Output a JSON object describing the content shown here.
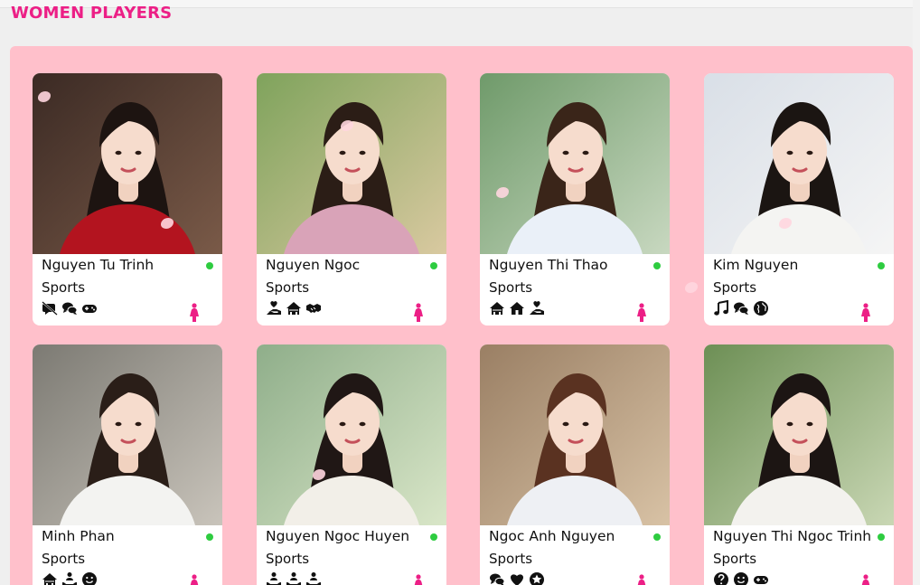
{
  "page": {
    "section_title": "WOMEN PLAYERS",
    "accent_color": "#ec1f86",
    "panel_color": "#ffc0cb",
    "online_color": "#2ecc40"
  },
  "players": [
    {
      "name": "Nguyen Tu Trinh",
      "category": "Sports",
      "online": true,
      "gender_icon": "female-icon",
      "hobby_icons": [
        "no-chat-icon",
        "chat-bubbles-icon",
        "gamepad-icon"
      ]
    },
    {
      "name": "Nguyen Ngoc",
      "category": "Sports",
      "online": true,
      "gender_icon": "female-icon",
      "hobby_icons": [
        "hand-heart-icon",
        "house-icon",
        "handshake-icon"
      ]
    },
    {
      "name": "Nguyen Thi Thao",
      "category": "Sports",
      "online": true,
      "gender_icon": "female-icon",
      "hobby_icons": [
        "house-icon",
        "home-icon",
        "hand-heart-icon"
      ]
    },
    {
      "name": "Kim Nguyen",
      "category": "Sports",
      "online": true,
      "gender_icon": "female-icon",
      "hobby_icons": [
        "music-icon",
        "chat-bubbles-icon",
        "globe-icon"
      ]
    },
    {
      "name": "Minh Phan",
      "category": "Sports",
      "online": true,
      "gender_icon": "female-icon",
      "hobby_icons": [
        "house-icon",
        "people-icon",
        "smile-icon"
      ]
    },
    {
      "name": "Nguyen Ngoc Huyen",
      "category": "Sports",
      "online": true,
      "gender_icon": "female-icon",
      "hobby_icons": [
        "people-icon",
        "people-icon",
        "people-icon"
      ]
    },
    {
      "name": "Ngoc Anh Nguyen",
      "category": "Sports",
      "online": true,
      "gender_icon": "female-icon",
      "hobby_icons": [
        "chat-bubbles-icon",
        "heart-icon",
        "star-icon"
      ]
    },
    {
      "name": "Nguyen Thi Ngoc Trinh",
      "category": "Sports",
      "online": true,
      "gender_icon": "female-icon",
      "hobby_icons": [
        "question-icon",
        "smile-icon",
        "gamepad-icon"
      ]
    }
  ]
}
